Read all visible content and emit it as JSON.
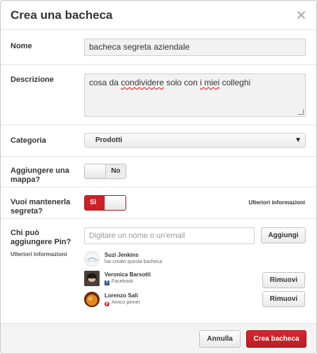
{
  "dialog": {
    "title": "Crea una bacheca"
  },
  "name": {
    "label": "Nome",
    "value": "bacheca segreta aziendale"
  },
  "description": {
    "label": "Descrizione",
    "value_before": "cosa da ",
    "value_misspelled_1": "condividere",
    "value_middle": " solo con ",
    "value_misspelled_2": "i miei",
    "value_after": " colleghi"
  },
  "category": {
    "label": "Categoria",
    "selected": "Prodotti"
  },
  "map": {
    "label": "Aggiungere una mappa?",
    "toggle_label": "No",
    "on": false
  },
  "secret": {
    "label": "Vuoi mantenerla segreta?",
    "toggle_label": "Sì",
    "on": true,
    "more_info": "Ulteriori informazioni"
  },
  "collaborators": {
    "label": "Chi può aggiungere Pin?",
    "more_info": "Ulteriori informazioni",
    "input_placeholder": "Digitare un nome o un'email",
    "add_button": "Aggiungi",
    "remove_button": "Rimuovi",
    "people": [
      {
        "name": "Suzi Jenkins",
        "meta": "hai creato questa bacheca",
        "source": ""
      },
      {
        "name": "Veronica Barsotti",
        "meta": "Facebook",
        "source": "facebook-icon"
      },
      {
        "name": "Lorenzo Sali",
        "meta": "Amico pinner",
        "source": "pinterest-icon"
      }
    ]
  },
  "footer": {
    "cancel": "Annulla",
    "create": "Crea bacheca"
  },
  "colors": {
    "accent": "#cb2027",
    "facebook": "#3b5998"
  }
}
